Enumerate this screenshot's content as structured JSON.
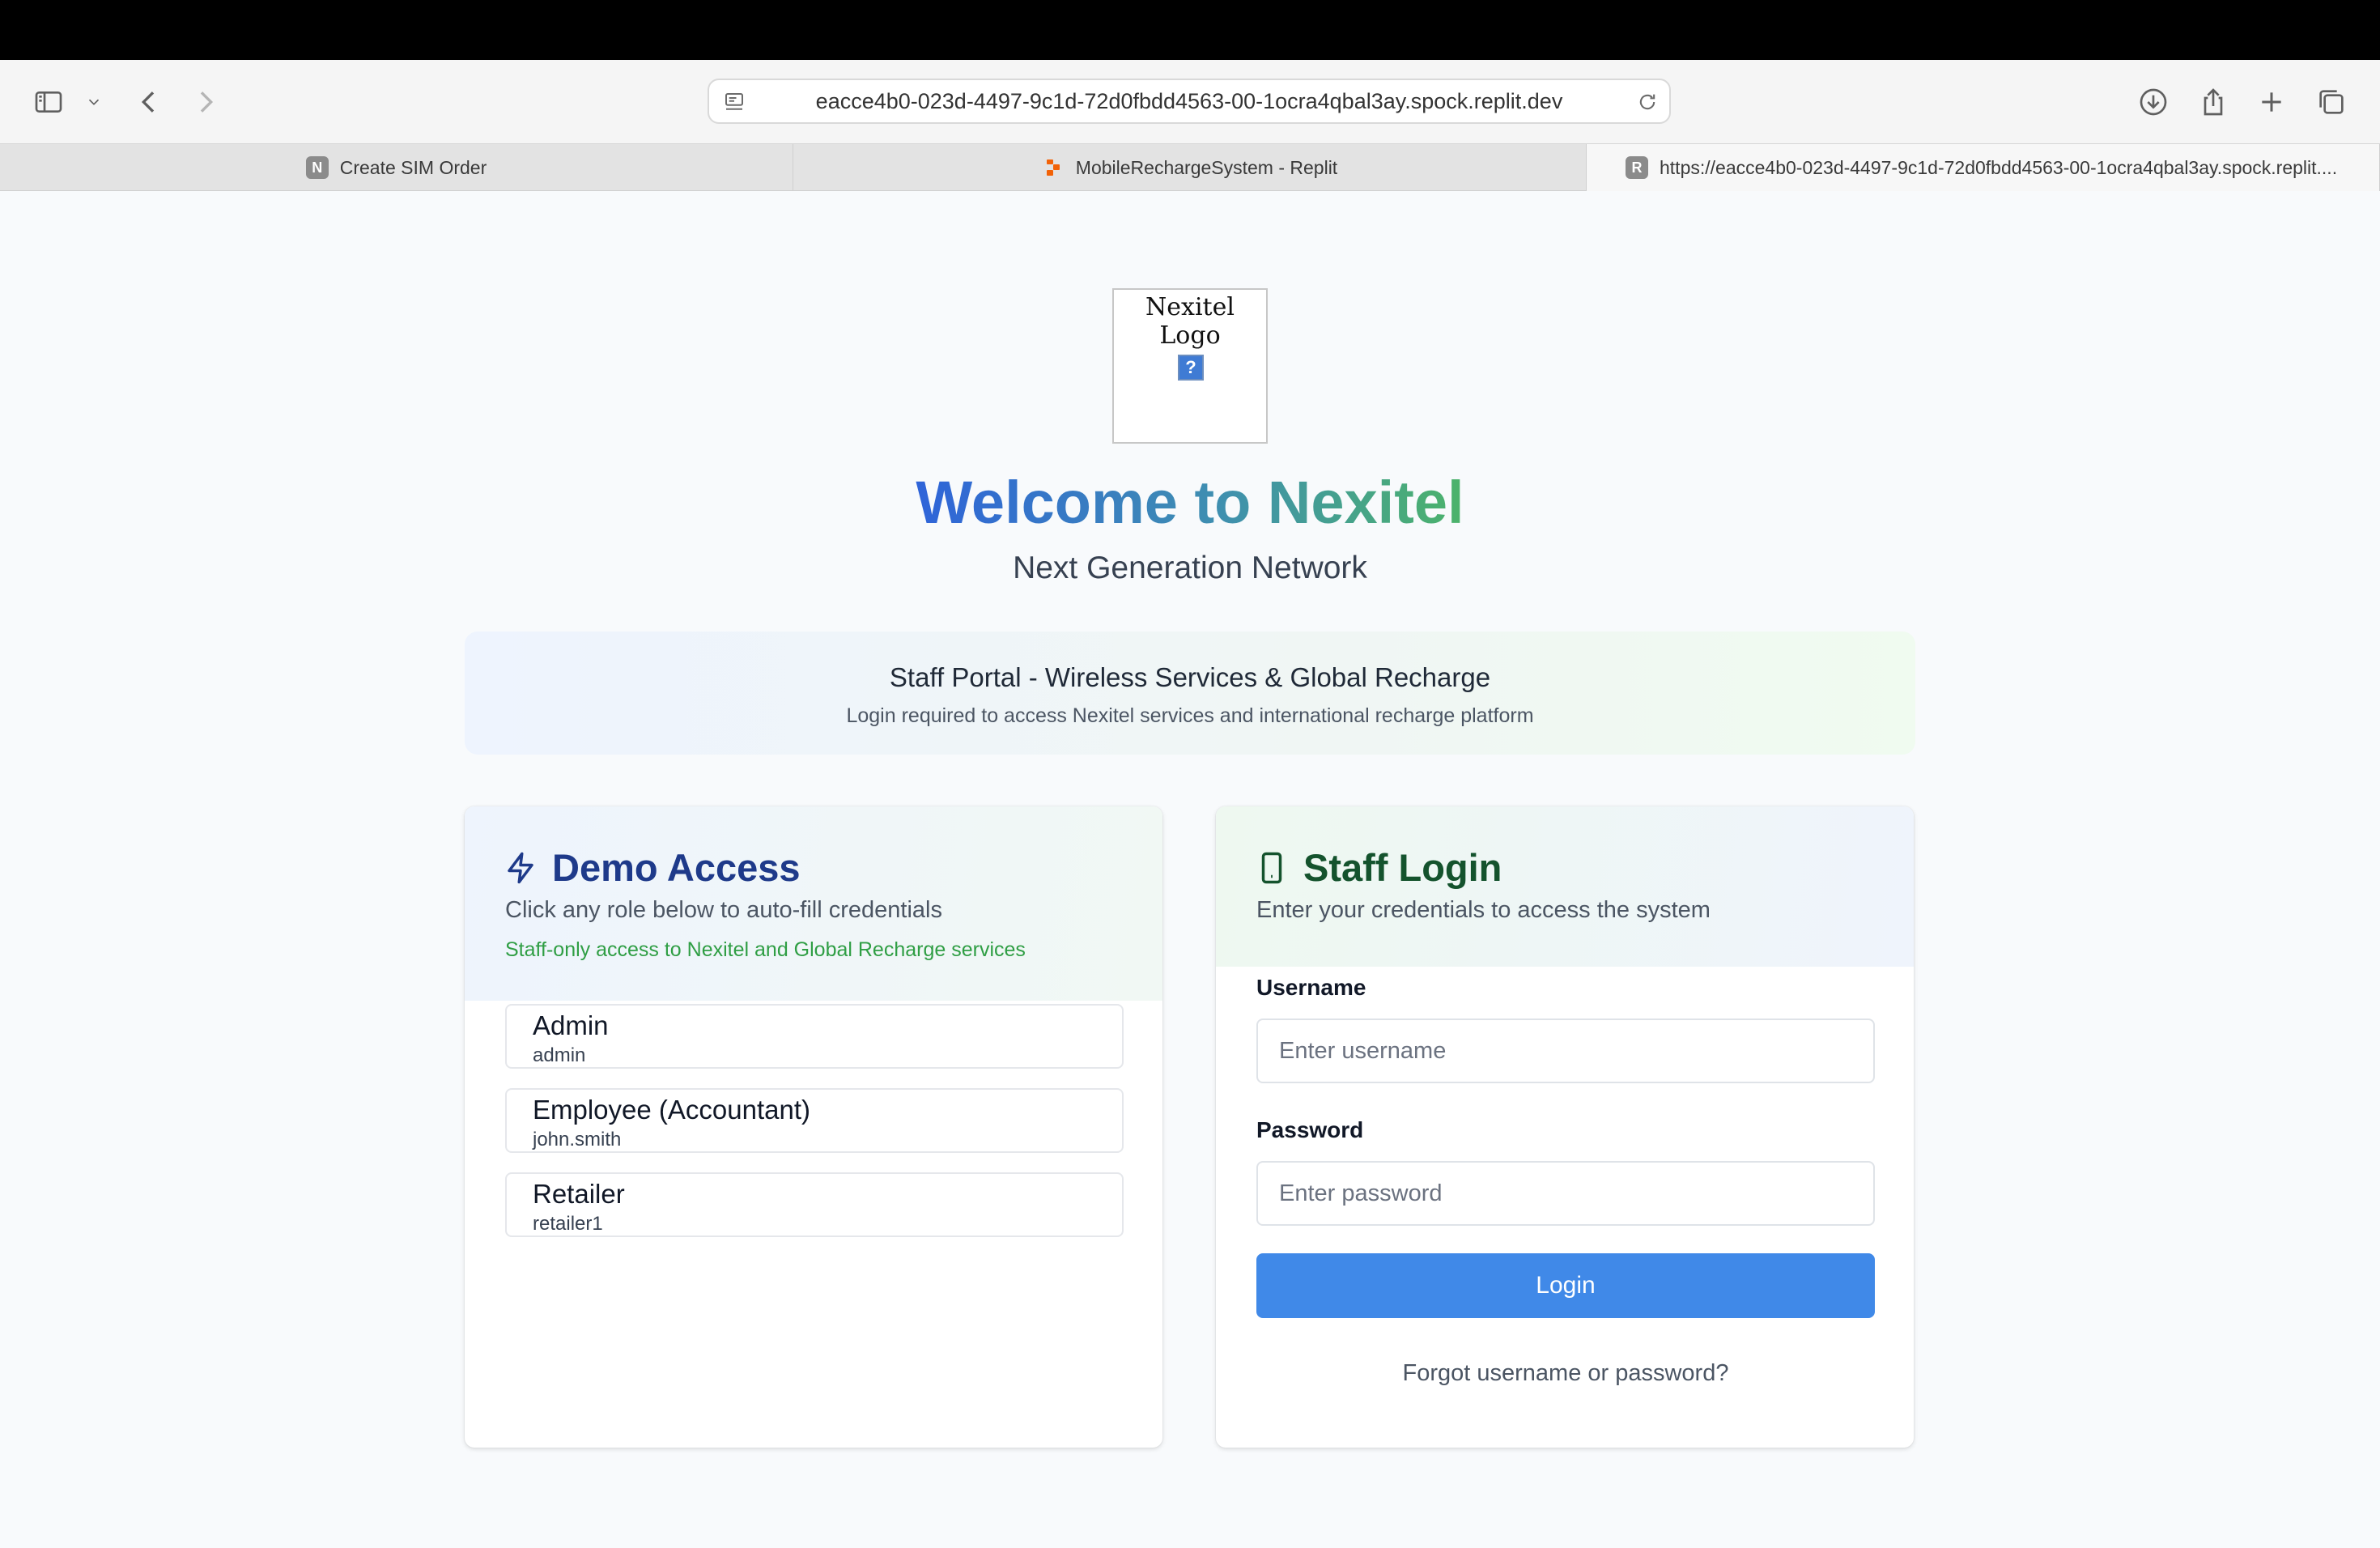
{
  "browser": {
    "url": "eacce4b0-023d-4497-9c1d-72d0fbdd4563-00-1ocra4qbal3ay.spock.replit.dev",
    "tabs": [
      {
        "label": "Create SIM Order",
        "favicon_letter": "N",
        "active": false
      },
      {
        "label": "MobileRechargeSystem - Replit",
        "favicon": "replit-icon",
        "active": false
      },
      {
        "label": "https://eacce4b0-023d-4497-9c1d-72d0fbdd4563-00-1ocra4qbal3ay.spock.replit....",
        "favicon_letter": "R",
        "active": true
      }
    ]
  },
  "page": {
    "logo_alt": "Nexitel Logo",
    "welcome": "Welcome to Nexitel",
    "tagline": "Next Generation Network",
    "banner": {
      "title": "Staff Portal - Wireless Services & Global Recharge",
      "subtitle": "Login required to access Nexitel services and international recharge platform"
    },
    "demo": {
      "title": "Demo Access",
      "icon": "lightning-icon",
      "description": "Click any role below to auto-fill credentials",
      "note": "Staff-only access to Nexitel and Global Recharge services",
      "roles": [
        {
          "name": "Admin",
          "username": "admin"
        },
        {
          "name": "Employee (Accountant)",
          "username": "john.smith"
        },
        {
          "name": "Retailer",
          "username": "retailer1"
        }
      ]
    },
    "login": {
      "title": "Staff Login",
      "icon": "smartphone-icon",
      "description": "Enter your credentials to access the system",
      "username_label": "Username",
      "username_placeholder": "Enter username",
      "password_label": "Password",
      "password_placeholder": "Enter password",
      "button": "Login",
      "forgot": "Forgot username or password?"
    }
  },
  "colors": {
    "primary_button": "#4089e8",
    "demo_title": "#1e3a8a",
    "login_title": "#14532d",
    "note_green": "#2f9e44"
  }
}
